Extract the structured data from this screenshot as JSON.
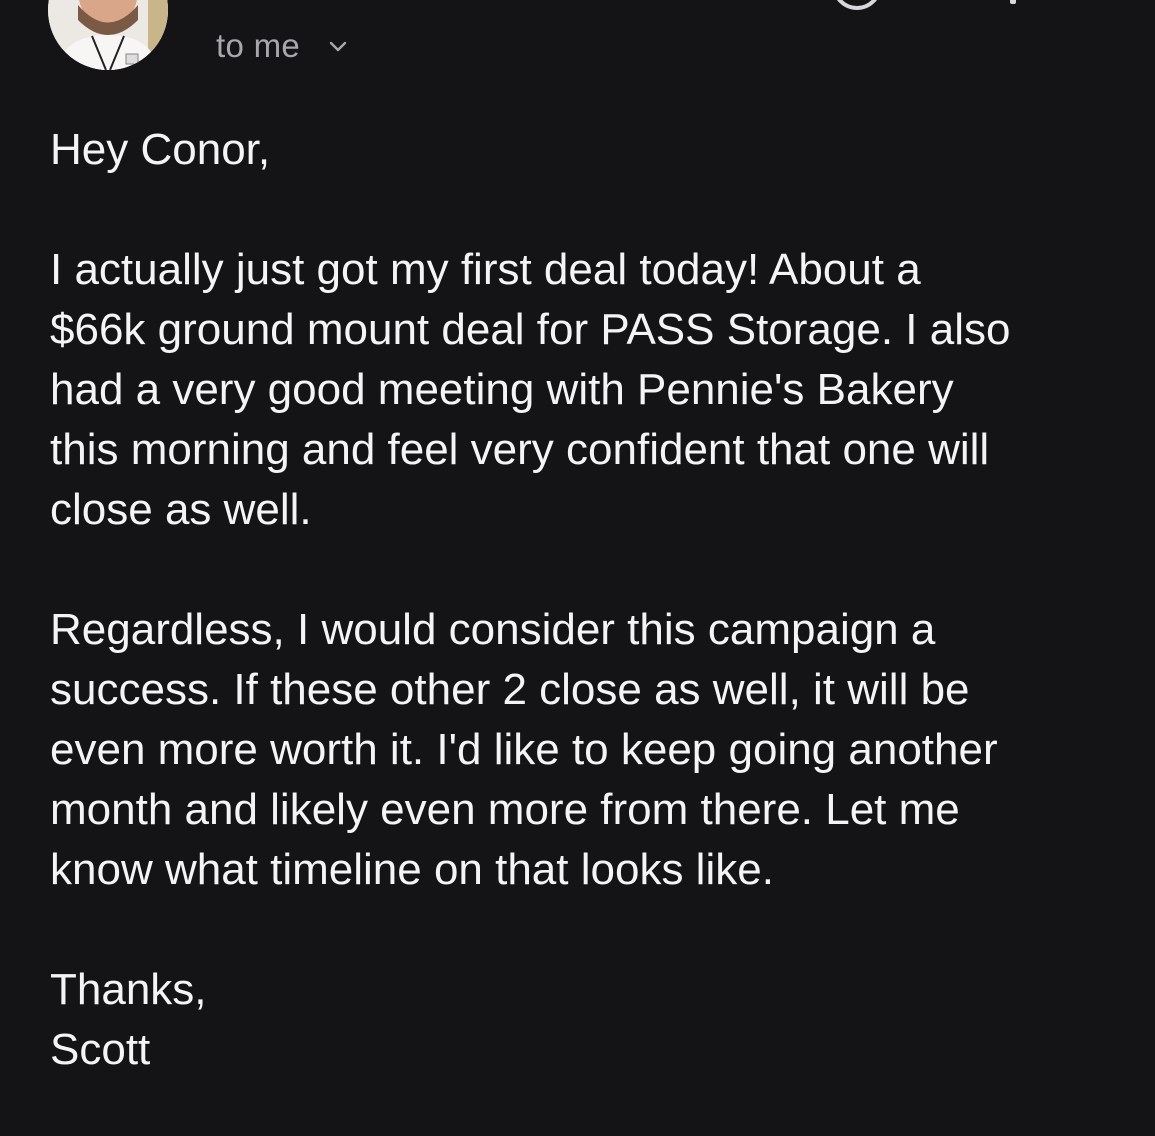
{
  "header": {
    "recipient_label": "to me",
    "icons": {
      "avatar": "sender-avatar",
      "chevron": "chevron-down-icon",
      "status": "circle-icon"
    }
  },
  "message": {
    "greeting": "Hey Conor,",
    "paragraph_1": "I actually just got my first deal today! About a\n$66k ground mount deal for PASS Storage. I also\nhad a very good meeting with Pennie's Bakery\nthis morning and feel very confident that one will\nclose as well.",
    "paragraph_2": "Regardless, I would consider this campaign a\nsuccess. If these other 2 close as well, it will be\neven more worth it. I'd like to keep going another\nmonth and likely even more from there. Let me\nknow what timeline on that looks like.",
    "signoff": "Thanks,",
    "signature": "Scott"
  },
  "colors": {
    "background": "#141316",
    "text": "#f4f4f6",
    "secondary_text": "#a7a7ad"
  }
}
